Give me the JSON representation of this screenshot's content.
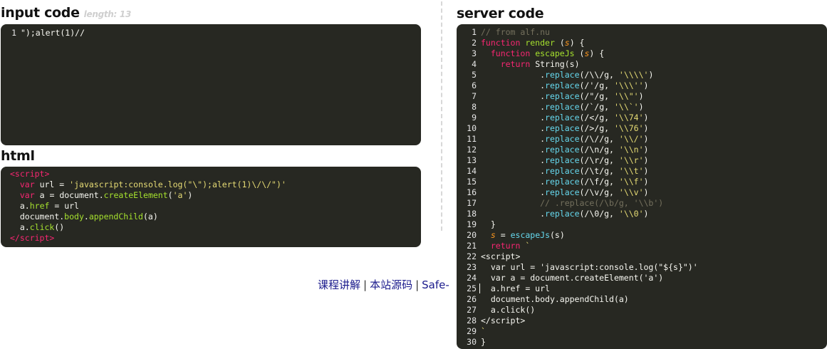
{
  "input_section": {
    "title": "input code",
    "length_label": "length: 13",
    "line_number": "1",
    "code": "\");alert(1)//"
  },
  "html_section": {
    "title": "html"
  },
  "server_section": {
    "title": "server code"
  },
  "footer": {
    "link1": "课程讲解",
    "sep": "|",
    "link2": "本站源码",
    "link3": "Safe-"
  }
}
